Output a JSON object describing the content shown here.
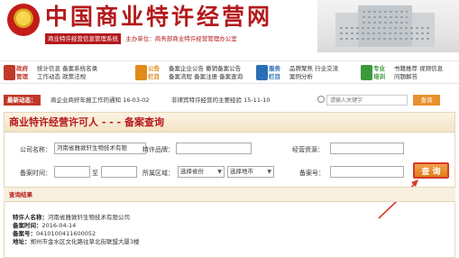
{
  "header": {
    "title": "中国商业特许经营网",
    "subtitle": "商业特许经营信息管理系统",
    "sponsor": "主办单位：商务部商业特许经营管理办公室"
  },
  "nav": [
    {
      "category": "政府\n管理",
      "color": "#c0392b",
      "links": [
        "统计信息  备案系统名录",
        "工作动态  政策法规"
      ]
    },
    {
      "category": "公告\n栏目",
      "color": "#e08a1a",
      "links": [
        "备案企业公告  撤销备案公告",
        "备案流程  备案注册  备案查询"
      ]
    },
    {
      "category": "服务\n栏目",
      "color": "#2a6fb3",
      "links": [
        "品牌聚焦  行业交流",
        "案例分析"
      ]
    },
    {
      "category": "专业\n培训",
      "color": "#3a9a3a",
      "links": [
        "书籍推荐  视频信息",
        "问题解答"
      ]
    }
  ],
  "news": {
    "badge": "最新动态：",
    "items": [
      "商企业商好年报工作的通知 16-03-02",
      "非律宾特许经营的主要经验  15-11-10"
    ],
    "search_placeholder": "请输入关键字",
    "search_button": "查询"
  },
  "panel": {
    "title": "商业特许经营许可人 - - - 备案查询",
    "company_label": "公司名称：",
    "company_value": "河南省雅敦轩生物技术有限",
    "brand_label": "特许品牌：",
    "brand_value": "",
    "resource_label": "经营资源：",
    "resource_value": "",
    "date_label": "备案时间：",
    "date_from": "",
    "date_to_label": "至",
    "date_to": "",
    "region_label": "所属区域：",
    "province_select": "选择省份",
    "city_select": "选择地市",
    "record_no_label": "备案号：",
    "record_no_value": "",
    "query_button": "查 询"
  },
  "result": {
    "header": "查询结果",
    "lines": [
      {
        "label": "特许人名称：",
        "value": "河南省雅敦轩生物技术有限公司"
      },
      {
        "label": "备案时间：",
        "value": "2016-04-14"
      },
      {
        "label": "备案号：",
        "value": "0410100411600052"
      },
      {
        "label": "地址：",
        "value": "郑州市金水区文化路往草北街联盟大厦3楼"
      }
    ]
  }
}
